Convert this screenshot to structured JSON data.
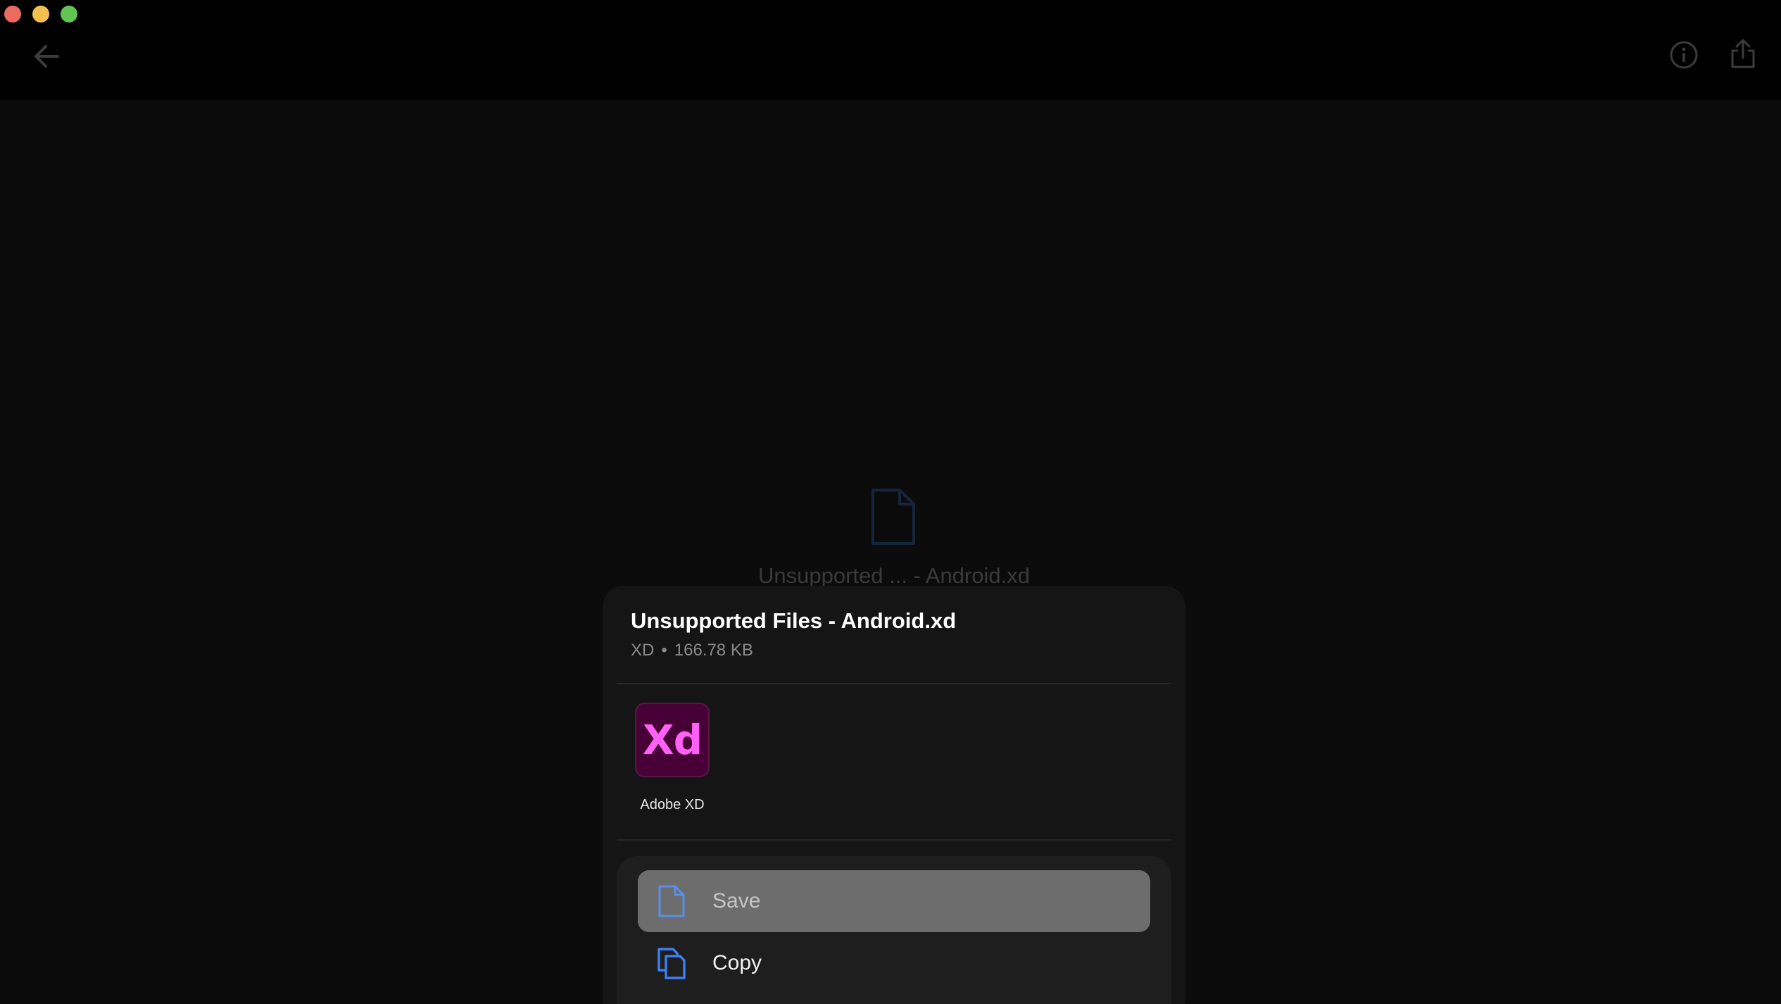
{
  "window": {
    "traffic_lights": {
      "close": "#ed6a5e",
      "minimize": "#f5bf4f",
      "zoom": "#61c554"
    }
  },
  "toolbar": {
    "back_icon": "arrow-left-icon",
    "info_icon": "info-icon",
    "share_icon": "share-icon"
  },
  "preview": {
    "file_icon": "document-icon",
    "filename": "Unsupported ... - Android.xd"
  },
  "sheet": {
    "title": "Unsupported Files - Android.xd",
    "file_type": "XD",
    "separator": "•",
    "file_size": "166.78 KB",
    "apps": [
      {
        "label": "Adobe XD",
        "icon_text": "Xd",
        "icon_bg": "#470137",
        "icon_fg": "#ff61f6"
      }
    ],
    "actions": [
      {
        "label": "Save",
        "icon": "document-icon"
      },
      {
        "label": "Copy",
        "icon": "copy-icon"
      }
    ],
    "accent_color": "#3d7ff5"
  }
}
